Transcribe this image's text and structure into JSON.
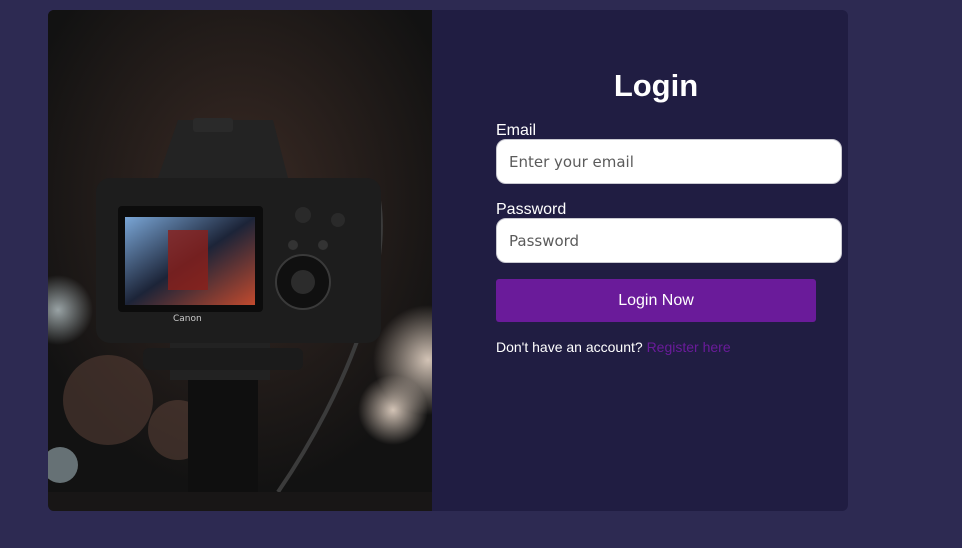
{
  "login": {
    "title": "Login",
    "email_label": "Email",
    "email_placeholder": "Enter your email",
    "password_label": "Password",
    "password_placeholder": "Password",
    "submit_label": "Login Now",
    "footer_text": "Don't have an account?",
    "register_link": "Register here"
  },
  "image": {
    "description_icon": "camera-photo",
    "camera_brand": "Canon"
  },
  "colors": {
    "page_bg": "#2d2a52",
    "card_bg": "#201d42",
    "accent": "#6a1b9a",
    "text": "#ffffff"
  }
}
